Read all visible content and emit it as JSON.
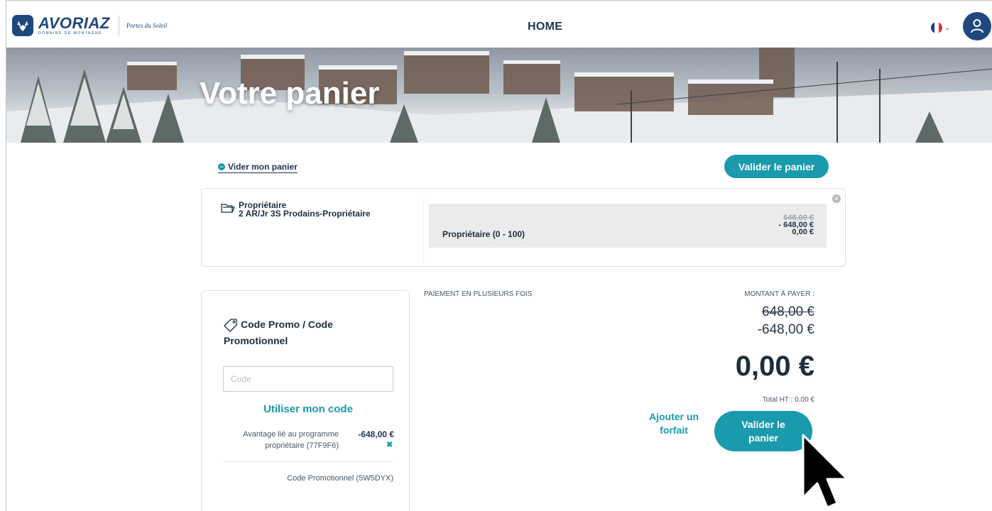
{
  "header": {
    "brand": "AVORIAZ",
    "brand_sub": "DOMAINE DE MONTAGNE",
    "partner": "Portes du Soleil",
    "nav_home": "HOME",
    "language_icon": "flag-fr-icon",
    "account_icon": "user-icon"
  },
  "hero": {
    "title": "Votre panier"
  },
  "cart": {
    "empty_link": "Vider mon panier",
    "validate_top": "Valider le panier",
    "item": {
      "product_type": "Propriétaire",
      "product_name": "2 AR/Jr 3S Prodains-Propriétaire",
      "category": "Propriétaire (0 - 100)",
      "price_old": "648,00 €",
      "price_discount": "- 648,00 €",
      "price_final": "0,00 €"
    }
  },
  "promo": {
    "title": "Code Promo / Code Promotionnel",
    "placeholder": "Code",
    "use_button": "Utiliser mon code",
    "advantage_label": "Avantage lié au programme propriétaire (77F9F6)",
    "advantage_amount": "-648,00 €",
    "second_code": "Code Promotionnel (5W5DYX)"
  },
  "payment": {
    "split_label": "PAIEMENT EN PLUSIEURS FOIS",
    "amount_label": "MONTANT À PAYER :",
    "old": "648,00 €",
    "discount": "-648,00 €",
    "total": "0,00 €",
    "total_ht": "Total HT : 0,00 €",
    "add_pass": "Ajouter un forfait",
    "validate": "Valider le panier"
  },
  "colors": {
    "accent": "#199aad",
    "navy": "#20477e",
    "text": "#1f2d3d"
  }
}
